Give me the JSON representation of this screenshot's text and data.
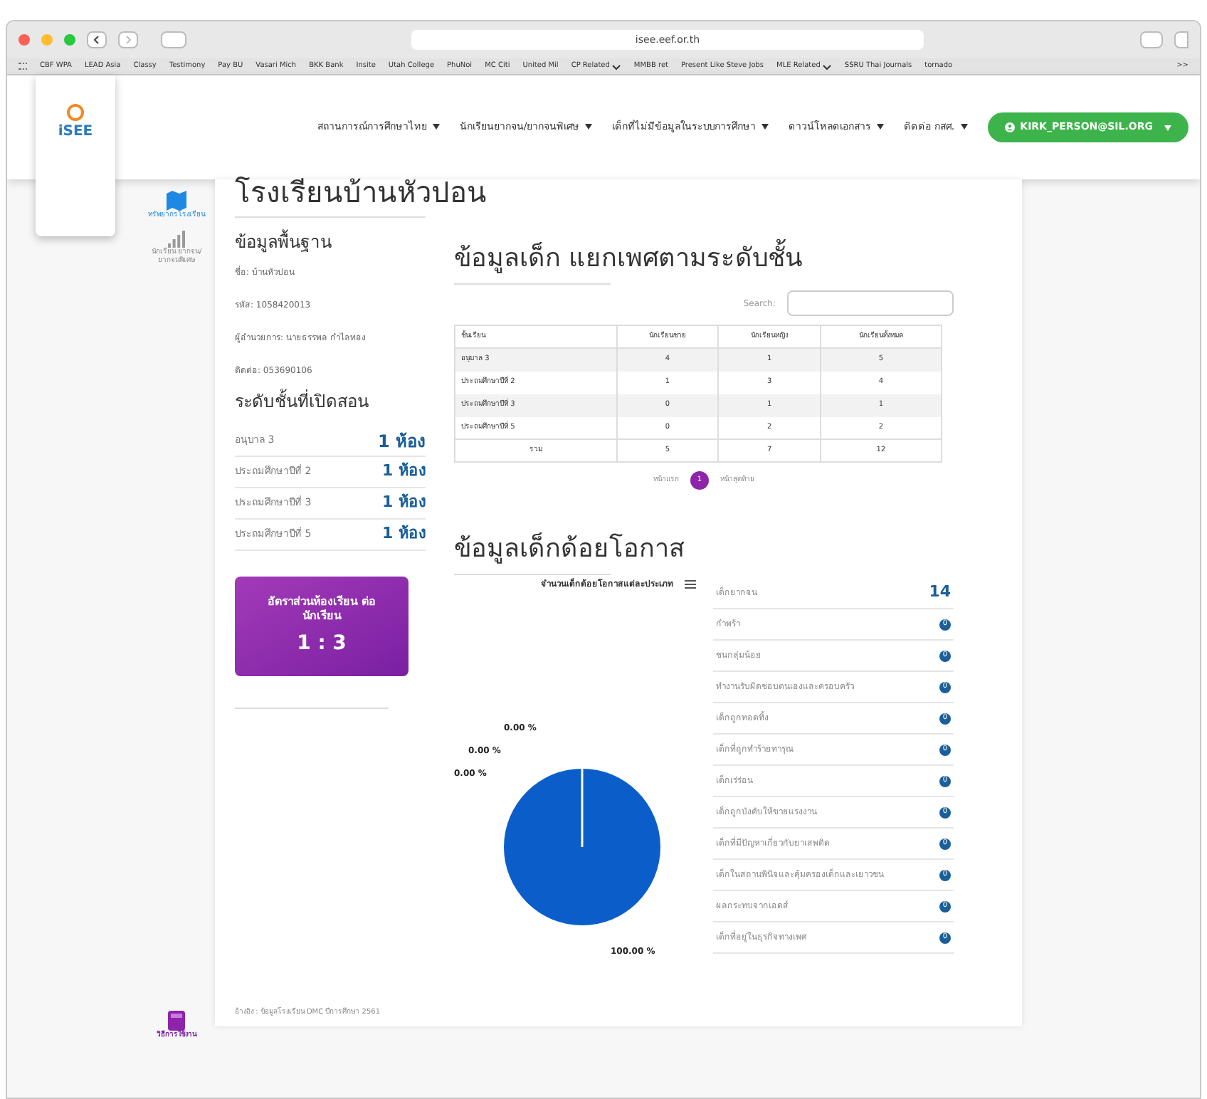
{
  "browser": {
    "url": "isee.eef.or.th",
    "bookmarks": [
      {
        "label": "CBF WPA",
        "menu": false
      },
      {
        "label": "LEAD Asia",
        "menu": false
      },
      {
        "label": "Classy",
        "menu": false
      },
      {
        "label": "Testimony",
        "menu": false
      },
      {
        "label": "Pay BU",
        "menu": false
      },
      {
        "label": "Vasari Mich",
        "menu": false
      },
      {
        "label": "BKK Bank",
        "menu": false
      },
      {
        "label": "Insite",
        "menu": false
      },
      {
        "label": "Utah College",
        "menu": false
      },
      {
        "label": "PhuNoi",
        "menu": false
      },
      {
        "label": "MC Citi",
        "menu": false
      },
      {
        "label": "United Mil",
        "menu": false
      },
      {
        "label": "CP Related",
        "menu": true
      },
      {
        "label": "MMBB ret",
        "menu": false
      },
      {
        "label": "Present Like Steve Jobs",
        "menu": false
      },
      {
        "label": "MLE Related",
        "menu": true
      },
      {
        "label": "SSRU Thai Journals",
        "menu": false
      },
      {
        "label": "tornado",
        "menu": false
      }
    ],
    "more": ">>"
  },
  "logo": {
    "text": "iSEE"
  },
  "nav": {
    "items": [
      "สถานการณ์การศึกษาไทย",
      "นักเรียนยากจน/ยากจนพิเศษ",
      "เด็กที่ไม่มีข้อมูลในระบบการศึกษา",
      "ดาวน์โหลดเอกสาร",
      "ติดต่อ กสศ."
    ],
    "user": "KIRK_PERSON@SIL.ORG"
  },
  "sidebar": {
    "items": [
      {
        "label": "ทรัพยากรโรงเรียน",
        "kind": "map",
        "disabled": false
      },
      {
        "label": "นักเรียน ยากจน/ ยากจนพิเศษ",
        "kind": "chart",
        "disabled": true
      }
    ],
    "help": "วิธีการใช้งาน"
  },
  "school": {
    "name": "โรงเรียนบ้านหัวปอน",
    "basic": {
      "title": "ข้อมูลพื้นฐาน",
      "lines": [
        "ชื่อ: บ้านหัวปอน",
        "รหัส: 1058420013",
        "ผู้อำนวยการ: นายธรรพล กำไลทอง",
        "ติดต่อ: 053690106"
      ]
    },
    "levels": {
      "title": "ระดับชั้นที่เปิดสอน",
      "rows": [
        {
          "label": "อนุบาล 3",
          "value": "1 ห้อง"
        },
        {
          "label": "ประถมศึกษาปีที่ 2",
          "value": "1 ห้อง"
        },
        {
          "label": "ประถมศึกษาปีที่ 3",
          "value": "1 ห้อง"
        },
        {
          "label": "ประถมศึกษาปีที่ 5",
          "value": "1 ห้อง"
        }
      ]
    },
    "ratio": {
      "label": "อัตราส่วนห้องเรียน ต่อนักเรียน",
      "value": "1 : 3"
    },
    "source": "อ้างอิง : ข้อมูลโรงเรียน DMC ปีการศึกษา 2561"
  },
  "students": {
    "title": "ข้อมูลเด็ก แยกเพศตามระดับชั้น",
    "search_label": "Search:",
    "columns": [
      "ชั้นเรียน",
      "นักเรียนชาย",
      "นักเรียนหญิง",
      "นักเรียนทั้งหมด"
    ],
    "rows": [
      [
        "อนุบาล 3",
        "4",
        "1",
        "5"
      ],
      [
        "ประถมศึกษาปีที่ 2",
        "1",
        "3",
        "4"
      ],
      [
        "ประถมศึกษาปีที่ 3",
        "0",
        "1",
        "1"
      ],
      [
        "ประถมศึกษาปีที่ 5",
        "0",
        "2",
        "2"
      ]
    ],
    "total": [
      "รวม",
      "5",
      "7",
      "12"
    ],
    "pagination": {
      "first": "หน้าแรก",
      "pages": [
        {
          "label": "1",
          "selected": true
        }
      ],
      "last": "หน้าสุดท้าย"
    }
  },
  "disadvantaged": {
    "title": "ข้อมูลเด็กด้อยโอกาส",
    "chart_title": "จำนวนเด็กด้อยโอกาสแต่ละประเภท",
    "chart_data": {
      "type": "pie",
      "values": [
        0,
        0,
        0,
        100
      ],
      "value_labels": [
        "0.00 %",
        "0.00 %",
        "0.00 %",
        "100.00 %"
      ],
      "colors": [
        "#8fb3e0",
        "#5b8ed6",
        "#2f6fcf",
        "#0b5ec9"
      ]
    },
    "items": [
      {
        "label": "เด็กยากจน",
        "value": "14",
        "kind": "number"
      },
      {
        "label": "กำพร้า",
        "value": "0",
        "kind": "badge"
      },
      {
        "label": "ชนกลุ่มน้อย",
        "value": "0",
        "kind": "badge"
      },
      {
        "label": "ทำงานรับผิดชอบตนเองและครอบครัว",
        "value": "0",
        "kind": "badge"
      },
      {
        "label": "เด็กถูกทอดทิ้ง",
        "value": "0",
        "kind": "badge"
      },
      {
        "label": "เด็กที่ถูกทำร้ายทารุณ",
        "value": "0",
        "kind": "badge"
      },
      {
        "label": "เด็กเร่ร่อน",
        "value": "0",
        "kind": "badge"
      },
      {
        "label": "เด็กถูกบังคับให้ขายแรงงาน",
        "value": "0",
        "kind": "badge"
      },
      {
        "label": "เด็กที่มีปัญหาเกี่ยวกับยาเสพติด",
        "value": "0",
        "kind": "badge"
      },
      {
        "label": "เด็กในสถานพินิจและคุ้มครองเด็กและเยาวชน",
        "value": "0",
        "kind": "badge"
      },
      {
        "label": "ผลกระทบจากเอดส์",
        "value": "0",
        "kind": "badge"
      },
      {
        "label": "เด็กที่อยู่ในธุรกิจทางเพศ",
        "value": "0",
        "kind": "badge"
      }
    ]
  }
}
